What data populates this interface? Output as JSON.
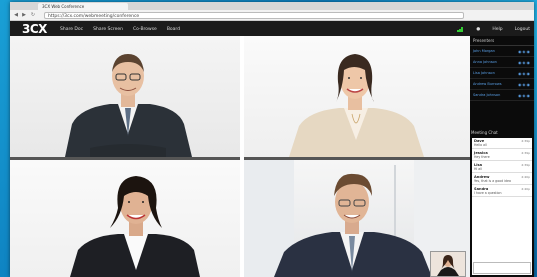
{
  "browser": {
    "tab_title": "3CX Web Conference",
    "url": "https://3cx.com/webmeeting/conference"
  },
  "app": {
    "logo_text": "3CX",
    "menu": [
      "Share Doc",
      "Share Screen",
      "Co-Browse",
      "Board"
    ],
    "right_menu": [
      "Help",
      "Logout"
    ]
  },
  "sidebar": {
    "participants_title": "Presenters",
    "participants": [
      {
        "name": "John Morgan"
      },
      {
        "name": "Anna Johnson"
      },
      {
        "name": "Lisa Johnson"
      },
      {
        "name": "Andrew Burrows"
      },
      {
        "name": "Sandra Johnson"
      }
    ]
  },
  "chat": {
    "title": "Meeting Chat",
    "messages": [
      {
        "name": "Dave",
        "text": "Hello all",
        "time": "2:39p"
      },
      {
        "name": "Jessica",
        "text": "Hey there",
        "time": "2:39p"
      },
      {
        "name": "Lisa",
        "text": "Hi all",
        "time": "2:39p"
      },
      {
        "name": "Andrew",
        "text": "Yes, that is a good idea",
        "time": "2:40p"
      },
      {
        "name": "Sandra",
        "text": "I have a question",
        "time": "2:40p"
      }
    ]
  },
  "colors": {
    "appbar": "#1b1b1b",
    "sidebar": "#0b0b0b",
    "accent": "#5aa0e8"
  }
}
